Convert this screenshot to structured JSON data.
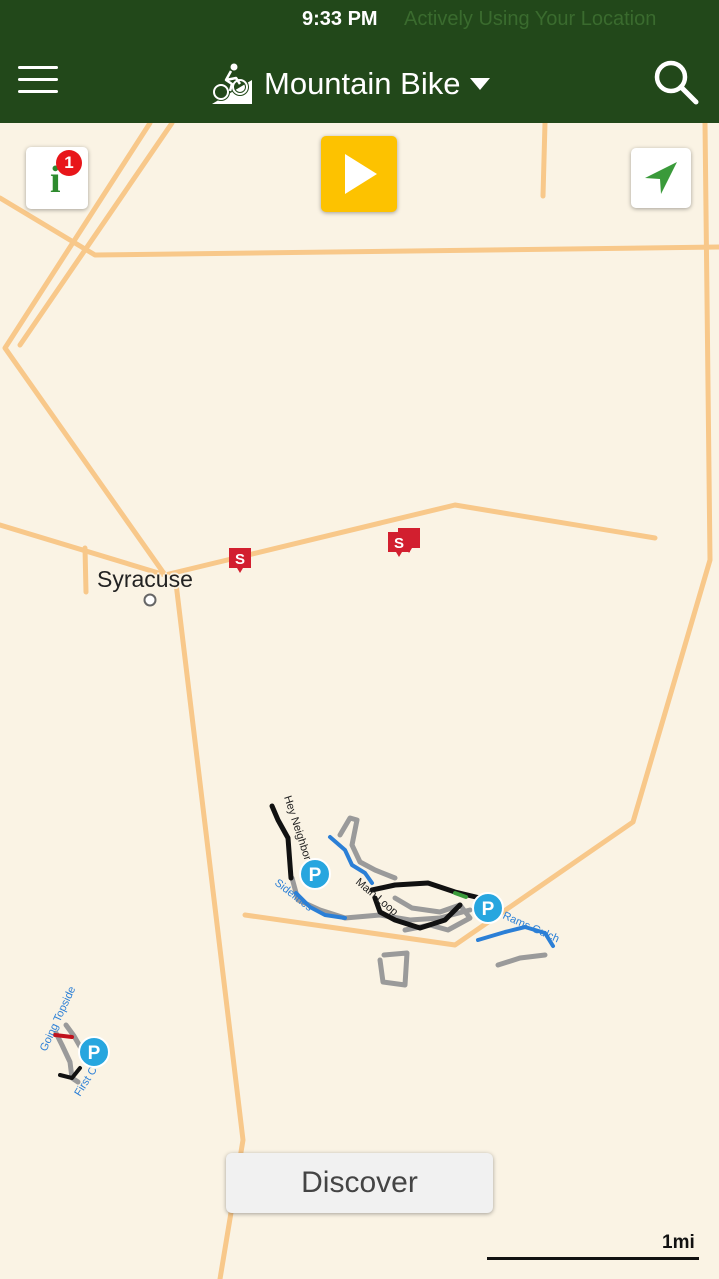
{
  "status_bar": {
    "time": "9:33 PM",
    "location_notice": "Actively Using Your Location"
  },
  "header": {
    "activity": "Mountain Bike",
    "activity_icon": "mountain-bike-icon",
    "menu_icon": "hamburger-menu-icon",
    "search_icon": "search-icon",
    "background_color": "#22481a"
  },
  "map_controls": {
    "info_glyph": "i",
    "info_badge_count": "1",
    "play_icon": "play-icon",
    "locate_icon": "navigation-arrow-icon",
    "play_color": "#fdc200"
  },
  "map": {
    "city_label": "Syracuse",
    "trail_labels": {
      "hey_neighbor": "Hey Neighbor",
      "sidelines": "Sidelines",
      "main_loop": "Main Loop",
      "rams_gulch": "Rams Gulch",
      "going_topside": "Going Topside",
      "first": "First C"
    },
    "parking_glyph": "P",
    "store_glyph": "S",
    "colors": {
      "land": "#faf3e4",
      "road": "#f8c88a",
      "trail_blue": "#2b7fd6",
      "trail_black": "#111111",
      "trail_gray": "#9a9a9a",
      "parking": "#27a6df",
      "store": "#d21f2f"
    }
  },
  "discover_button": {
    "label": "Discover"
  },
  "scale": {
    "label": "1mi"
  }
}
